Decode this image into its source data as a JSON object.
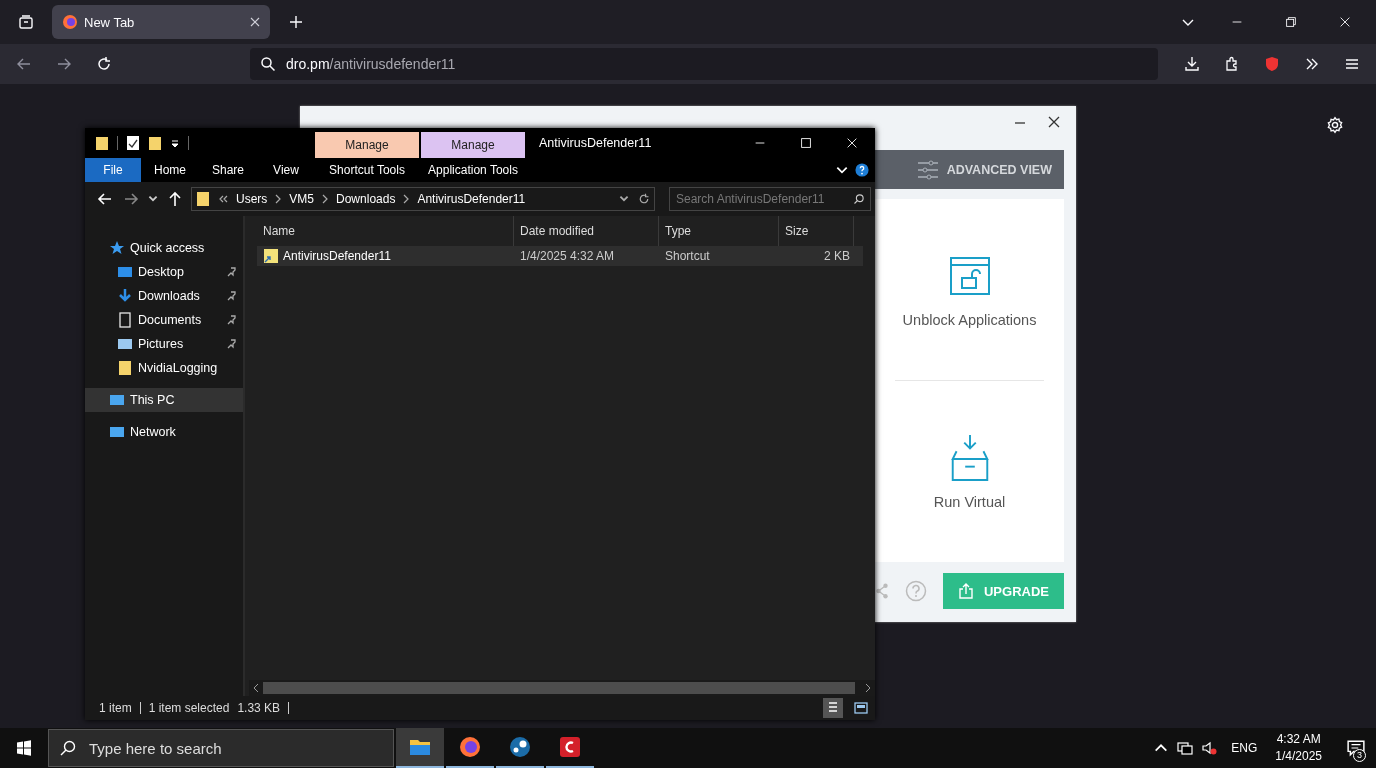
{
  "browser": {
    "tabs": [
      {
        "title": "New Tab",
        "selected": true
      }
    ],
    "address": {
      "host": "dro.pm",
      "path": "/antivirusdefender11"
    }
  },
  "comodo": {
    "advanced_view": "ADVANCED VIEW",
    "tasks": [
      {
        "label": "Unblock Applications",
        "kind": "unblock"
      },
      {
        "label": "Run Virtual",
        "kind": "virtual"
      }
    ],
    "upgrade": "UPGRADE"
  },
  "explorer": {
    "title": "AntivirusDefender11",
    "context_tabs": [
      {
        "group": "Manage",
        "label": "Shortcut Tools",
        "color": "#f9c9b0"
      },
      {
        "group": "Manage",
        "label": "Application Tools",
        "color": "#dcc3f2"
      }
    ],
    "ribbon_tabs": [
      {
        "label": "File",
        "kind": "file"
      },
      {
        "label": "Home",
        "kind": "tab"
      },
      {
        "label": "Share",
        "kind": "tab"
      },
      {
        "label": "View",
        "kind": "tab"
      }
    ],
    "breadcrumb": [
      "Users",
      "VM5",
      "Downloads",
      "AntivirusDefender11"
    ],
    "search": {
      "placeholder": "Search AntivirusDefender11"
    },
    "nav": [
      {
        "label": "Quick access",
        "kind": "star",
        "selected": false,
        "children": [
          {
            "label": "Desktop",
            "kind": "desktop",
            "pinned": true,
            "selected": false
          },
          {
            "label": "Downloads",
            "kind": "download",
            "pinned": true,
            "selected": false
          },
          {
            "label": "Documents",
            "kind": "document",
            "pinned": true,
            "selected": false
          },
          {
            "label": "Pictures",
            "kind": "pictures",
            "pinned": true,
            "selected": false
          },
          {
            "label": "NvidiaLogging",
            "kind": "folder",
            "pinned": false,
            "selected": false
          }
        ]
      },
      {
        "label": "This PC",
        "kind": "pc",
        "selected": true
      },
      {
        "label": "Network",
        "kind": "network",
        "selected": false
      }
    ],
    "columns": [
      "Name",
      "Date modified",
      "Type",
      "Size"
    ],
    "rows": [
      {
        "name": "AntivirusDefender11",
        "date": "1/4/2025 4:32 AM",
        "type": "Shortcut",
        "size": "2 KB",
        "selected": true
      }
    ],
    "status": {
      "count": "1 item",
      "selection": "1 item selected",
      "size": "1.33 KB"
    }
  },
  "taskbar": {
    "search_placeholder": "Type here to search",
    "apps": [
      {
        "kind": "explorer",
        "active": true
      },
      {
        "kind": "firefox",
        "active": false
      },
      {
        "kind": "steam",
        "active": false
      },
      {
        "kind": "comodo",
        "active": false
      }
    ],
    "language": "ENG",
    "time": "4:32 AM",
    "date": "1/4/2025",
    "notifications": "3"
  }
}
